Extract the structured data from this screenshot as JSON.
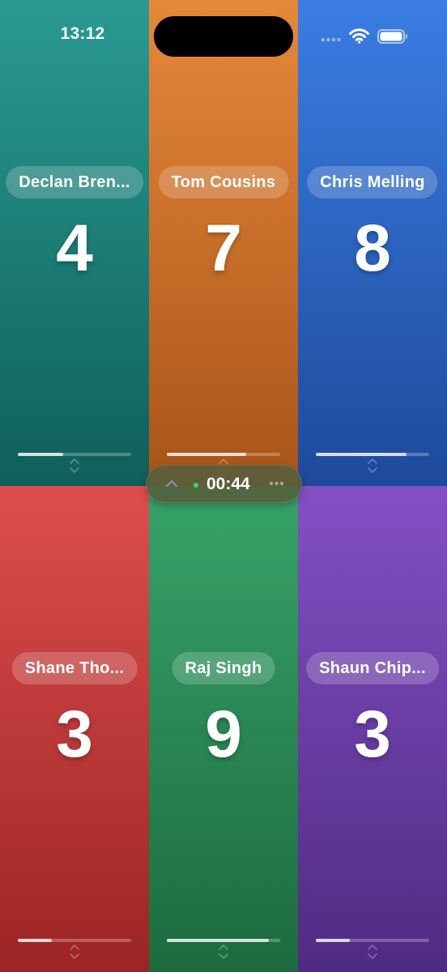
{
  "status_bar": {
    "time": "13:12",
    "icons": [
      "signal-dots-icon",
      "wifi-icon",
      "battery-icon"
    ]
  },
  "players": [
    {
      "name": "Declan Bren...",
      "score": "4",
      "progress": 0.4,
      "color": "#1f7d77"
    },
    {
      "name": "Tom Cousins",
      "score": "7",
      "progress": 0.7,
      "color": "#c96a25"
    },
    {
      "name": "Chris Melling",
      "score": "8",
      "progress": 0.8,
      "color": "#2f63c0"
    },
    {
      "name": "Shane Tho...",
      "score": "3",
      "progress": 0.3,
      "color": "#bd3636"
    },
    {
      "name": "Raj Singh",
      "score": "9",
      "progress": 0.9,
      "color": "#298552"
    },
    {
      "name": "Shaun Chip...",
      "score": "3",
      "progress": 0.3,
      "color": "#673ba3"
    }
  ],
  "timer": {
    "elapsed": "00:44",
    "running_color": "#3ed463",
    "icons": [
      "chevron-up-icon",
      "more-icon"
    ]
  }
}
